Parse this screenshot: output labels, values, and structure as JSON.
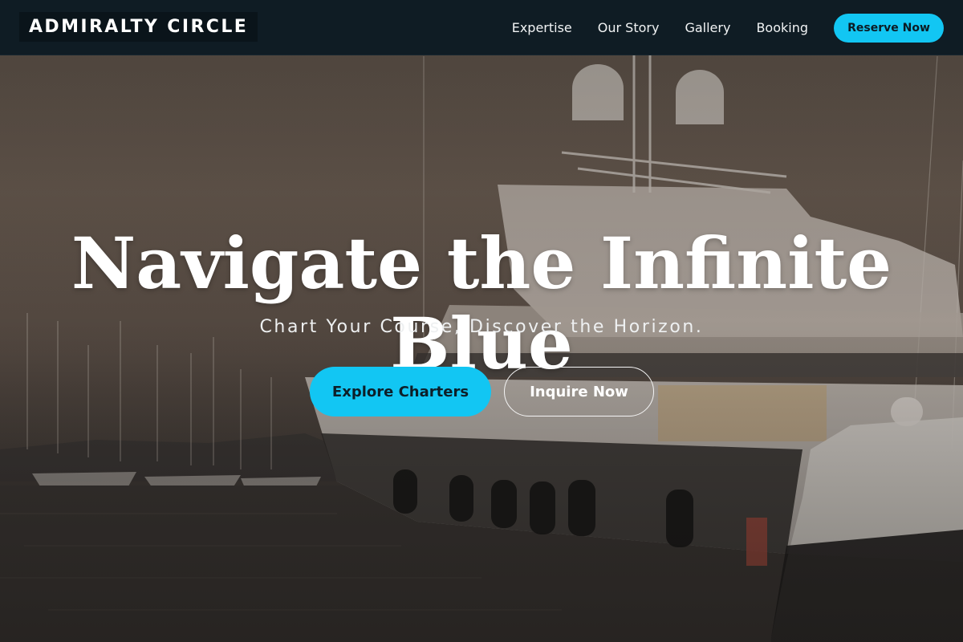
{
  "brand": {
    "name": "ADMIRALTY CIRCLE"
  },
  "nav": {
    "links": [
      "Expertise",
      "Our Story",
      "Gallery",
      "Booking"
    ],
    "cta_label": "Reserve Now"
  },
  "hero": {
    "title": "Navigate the Infinite Blue",
    "subtitle": "Chart Your Course, Discover the Horizon.",
    "primary_button": "Explore Charters",
    "secondary_button": "Inquire Now",
    "background_icon": "yacht-marina-photo"
  },
  "colors": {
    "accent": "#12c6f3",
    "nav_background": "#0f1c24",
    "text": "#ffffff"
  }
}
